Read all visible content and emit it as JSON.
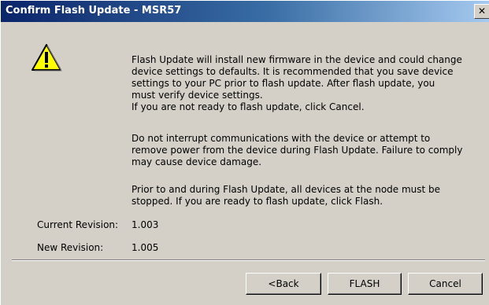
{
  "window": {
    "title": "Confirm Flash Update - MSR57",
    "close_glyph": "✕"
  },
  "icon": {
    "name": "warning-icon",
    "fill_color": "#ffff00",
    "glyph": "!"
  },
  "message": {
    "paragraph1_lines": [
      "Flash Update will install new firmware in the device and could change",
      "device settings to defaults. It is recommended that you save device",
      "settings to your PC prior to flash update. After flash update, you",
      "must verify device settings.",
      "If you are not ready to flash update, click Cancel."
    ],
    "paragraph2_lines": [
      "Do not interrupt communications with the device or attempt to",
      "remove power from the device during Flash Update. Failure to comply",
      "may cause device damage."
    ],
    "paragraph3_lines": [
      "Prior to and during Flash Update, all devices at the node must be",
      "stopped. If you are ready to flash update, click Flash."
    ]
  },
  "revision": {
    "current_label": "Current Revision:",
    "current_value": "1.003",
    "new_label": "New Revision:",
    "new_value": "1.005"
  },
  "buttons": {
    "back": "<Back",
    "flash": "FLASH",
    "cancel": "Cancel"
  }
}
